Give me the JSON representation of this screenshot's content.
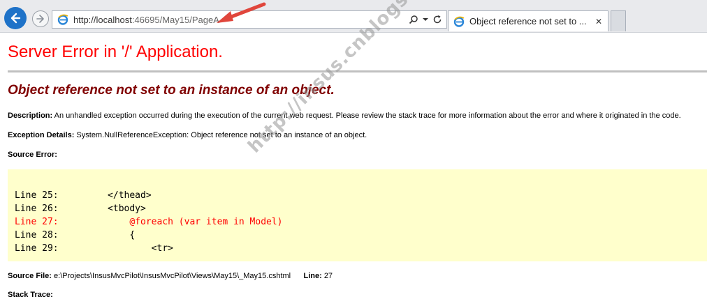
{
  "browser": {
    "address_host": "http://localhost",
    "address_rest": ":46695/May15/PageA",
    "tab_title": "Object reference not set to ...",
    "tab_close": "✕"
  },
  "error": {
    "title": "Server Error in '/' Application.",
    "message": "Object reference not set to an instance of an object.",
    "description_label": "Description:",
    "description_text": "An unhandled exception occurred during the execution of the current web request. Please review the stack trace for more information about the error and where it originated in the code.",
    "exception_label": "Exception Details:",
    "exception_text": "System.NullReferenceException: Object reference not set to an instance of an object.",
    "source_error_label": "Source Error:",
    "code_lines": [
      "Line 25:         </thead>",
      "Line 26:         <tbody>",
      "Line 27:             @foreach (var item in Model)",
      "Line 28:             {",
      "Line 29:                 <tr>"
    ],
    "source_file_label": "Source File:",
    "source_file_path": "e:\\Projects\\InsusMvcPilot\\InsusMvcPilot\\Views\\May15\\_May15.cshtml",
    "line_label": "Line:",
    "line_value": "27",
    "stack_trace_label": "Stack Trace:"
  },
  "watermark": "http://insus.cnblogs.com",
  "colors": {
    "title": "#ff0000",
    "message": "#800000",
    "code_bg": "#ffffcc",
    "error_line": "#ff0000",
    "back_button": "#1e72c8",
    "annotation_arrow": "#e0463c"
  }
}
